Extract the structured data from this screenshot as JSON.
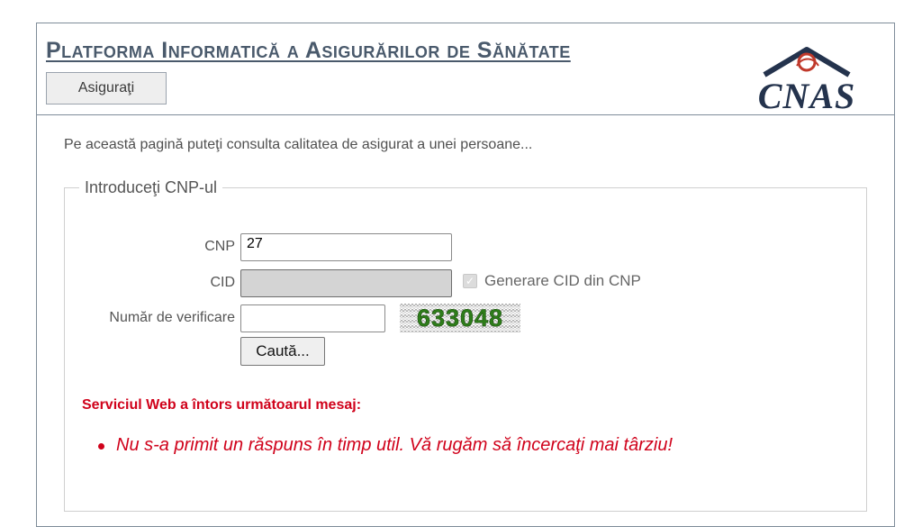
{
  "header": {
    "title": "Platforma Informatică a Asigurărilor de Sănătate",
    "nav_button": "Asiguraţi",
    "logo_text": "CNAS"
  },
  "main": {
    "intro": "Pe această pagină puteţi consulta calitatea de asigurat a unei persoane...",
    "fieldset_legend": "Introduceţi CNP-ul",
    "cnp_label": "CNP",
    "cnp_value": "27",
    "cid_label": "CID",
    "cid_value": "",
    "generate_cid_label": "Generare CID din CNP",
    "generate_cid_checked": true,
    "verify_label": "Număr de verificare",
    "verify_value": "",
    "captcha_text": "633048",
    "search_button": "Caută...",
    "error_heading": "Serviciul Web a întors următoarul mesaj:",
    "error_message": "Nu s-a primit un răspuns în timp util. Vă rugăm să încercaţi mai târziu!"
  },
  "colors": {
    "title": "#4a5a6c",
    "error": "#d0021b",
    "captcha_text": "#2e7d1a",
    "logo": "#24334d",
    "logo_accent": "#c0392b"
  }
}
